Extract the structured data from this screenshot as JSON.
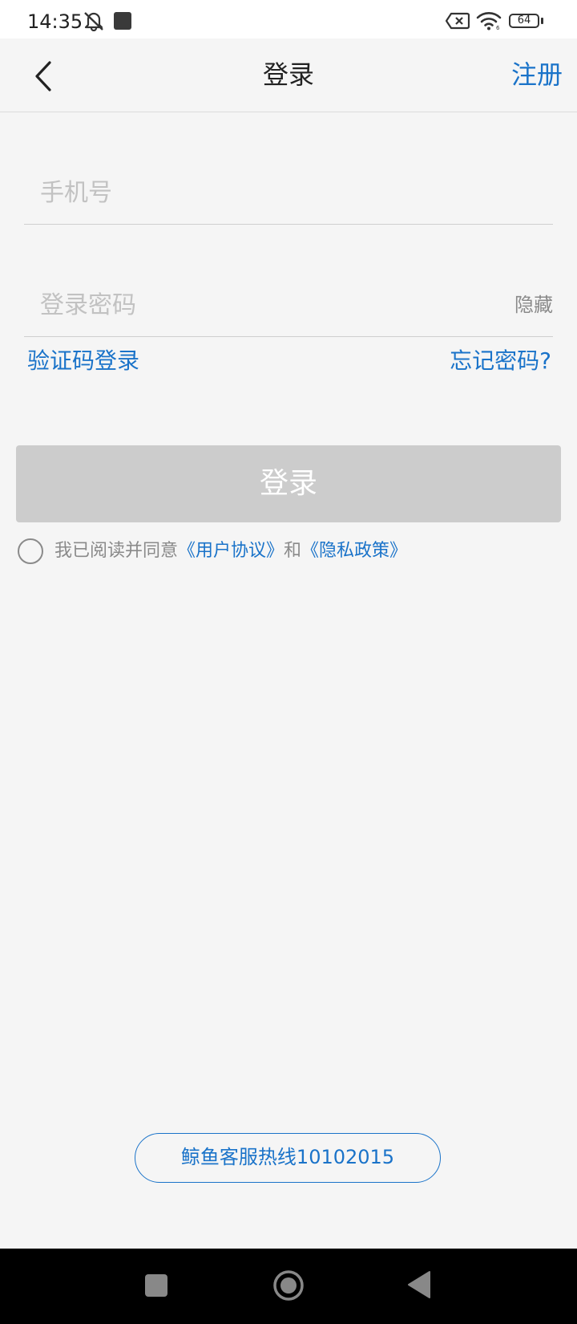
{
  "status_bar": {
    "time": "14:35",
    "battery": "64",
    "icons": [
      "bell-off-icon",
      "app-notification-icon",
      "no-sim-icon",
      "wifi-icon",
      "battery-icon"
    ]
  },
  "header": {
    "title": "登录",
    "register_label": "注册",
    "back_icon": "chevron-left-icon"
  },
  "form": {
    "phone_placeholder": "手机号",
    "password_placeholder": "登录密码",
    "password_toggle": "隐藏",
    "sms_login_label": "验证码登录",
    "forgot_password_label": "忘记密码?",
    "login_button": "登录"
  },
  "agreement": {
    "prefix": "我已阅读并同意",
    "user_agreement": "《用户协议》",
    "conjunction": "和",
    "privacy_policy": "《隐私政策》",
    "checked": false
  },
  "hotline": {
    "label": "鲸鱼客服热线10102015"
  },
  "system_nav": {
    "icons": [
      "recent-apps-icon",
      "home-icon",
      "back-triangle-icon"
    ]
  },
  "colors": {
    "accent": "#1a73c9",
    "background": "#f5f5f5",
    "button_disabled": "#cccccc",
    "placeholder": "#c2c2c2"
  }
}
